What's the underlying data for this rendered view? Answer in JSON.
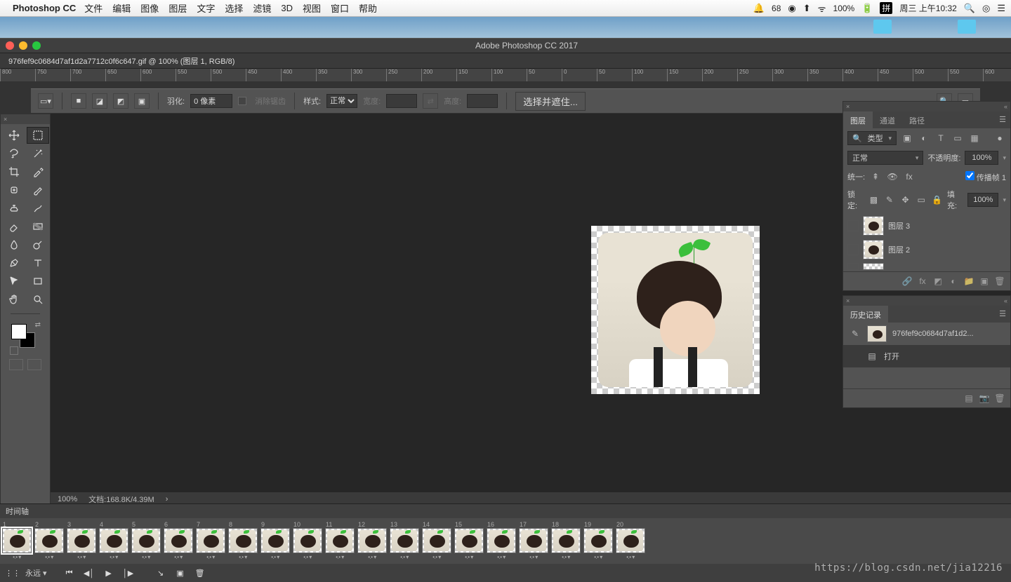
{
  "menubar": {
    "app": "Photoshop CC",
    "items": [
      "文件",
      "编辑",
      "图像",
      "图层",
      "文字",
      "选择",
      "滤镜",
      "3D",
      "视图",
      "窗口",
      "帮助"
    ],
    "right": {
      "notif_count": "68",
      "battery": "100%",
      "ime": "拼",
      "datetime": "周三 上午10:32"
    }
  },
  "window": {
    "title": "Adobe Photoshop CC 2017"
  },
  "doc_tab": "976fef9c0684d7af1d2a7712c0f6c647.gif @ 100% (图层 1, RGB/8)",
  "ruler_ticks": [
    "800",
    "750",
    "700",
    "650",
    "600",
    "550",
    "500",
    "450",
    "400",
    "350",
    "300",
    "250",
    "200",
    "150",
    "100",
    "50",
    "0",
    "50",
    "100",
    "150",
    "200",
    "250",
    "300",
    "350",
    "400",
    "450",
    "500",
    "550",
    "600"
  ],
  "optionsbar": {
    "feather_label": "羽化:",
    "feather_value": "0 像素",
    "antialias": "消除锯齿",
    "style_label": "样式:",
    "style_value": "正常",
    "width_label": "宽度:",
    "height_label": "高度:",
    "mask_btn": "选择并遮住..."
  },
  "status": {
    "zoom": "100%",
    "docinfo_label": "文档:",
    "docinfo": "168.8K/4.39M"
  },
  "layers_panel": {
    "tabs": [
      "图层",
      "通道",
      "路径"
    ],
    "filter_label": "类型",
    "blend": "正常",
    "opacity_label": "不透明度:",
    "opacity_value": "100%",
    "unify_label": "统一:",
    "propagate_label": "传播帧 1",
    "lock_label": "锁定:",
    "fill_label": "填充:",
    "fill_value": "100%",
    "layers": [
      {
        "name": "图层 3"
      },
      {
        "name": "图层 2"
      }
    ]
  },
  "history_panel": {
    "title": "历史记录",
    "doc_name": "976fef9c0684d7af1d2...",
    "entries": [
      {
        "name": "打开"
      }
    ]
  },
  "timeline": {
    "title": "时间轴",
    "loop": "永远",
    "frame_count": 20
  },
  "watermark": "https://blog.csdn.net/jia12216"
}
